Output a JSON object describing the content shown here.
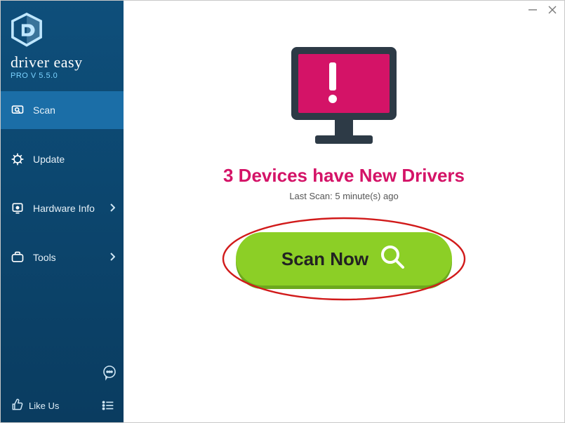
{
  "brand": {
    "name": "driver easy",
    "version": "PRO V 5.5.0"
  },
  "sidebar": {
    "items": [
      {
        "label": "Scan",
        "has_sub": false,
        "active": true
      },
      {
        "label": "Update",
        "has_sub": false,
        "active": false
      },
      {
        "label": "Hardware Info",
        "has_sub": true,
        "active": false
      },
      {
        "label": "Tools",
        "has_sub": true,
        "active": false
      }
    ],
    "like_label": "Like Us"
  },
  "main": {
    "headline": "3 Devices have New Drivers",
    "last_scan": "Last Scan: 5 minute(s) ago",
    "scan_button": "Scan Now"
  },
  "colors": {
    "accent_pink": "#d41367",
    "scan_green": "#8ccf26",
    "sidebar_top": "#0e4f7b"
  }
}
